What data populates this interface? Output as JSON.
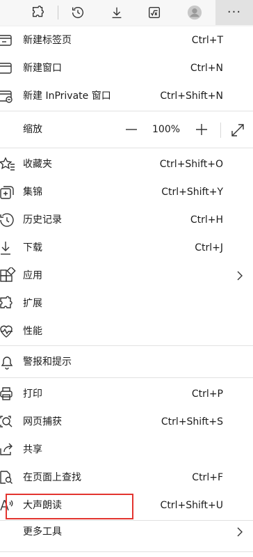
{
  "toolbar": {
    "icons": [
      "extensions-icon",
      "history-icon",
      "download-icon",
      "math-solver-icon",
      "profile-avatar-icon",
      "more-icon"
    ],
    "more_label": "···"
  },
  "menu": {
    "new_tab": {
      "label": "新建标签页",
      "shortcut": "Ctrl+T"
    },
    "new_window": {
      "label": "新建窗口",
      "shortcut": "Ctrl+N"
    },
    "new_inprivate": {
      "label": "新建 InPrivate 窗口",
      "shortcut": "Ctrl+Shift+N"
    },
    "zoom": {
      "label": "缩放",
      "value": "100%",
      "minus": "−",
      "plus": "+"
    },
    "favorites": {
      "label": "收藏夹",
      "shortcut": "Ctrl+Shift+O"
    },
    "collections": {
      "label": "集锦",
      "shortcut": "Ctrl+Shift+Y"
    },
    "history": {
      "label": "历史记录",
      "shortcut": "Ctrl+H"
    },
    "downloads": {
      "label": "下载",
      "shortcut": "Ctrl+J"
    },
    "apps": {
      "label": "应用"
    },
    "extensions": {
      "label": "扩展"
    },
    "performance": {
      "label": "性能"
    },
    "alerts": {
      "label": "警报和提示"
    },
    "print": {
      "label": "打印",
      "shortcut": "Ctrl+P"
    },
    "web_capture": {
      "label": "网页捕获",
      "shortcut": "Ctrl+Shift+S"
    },
    "share": {
      "label": "共享"
    },
    "find": {
      "label": "在页面上查找",
      "shortcut": "Ctrl+F"
    },
    "read_aloud": {
      "label": "大声朗读",
      "shortcut": "Ctrl+Shift+U"
    },
    "more_tools": {
      "label": "更多工具"
    }
  },
  "colors": {
    "highlight": "#e3342f",
    "menu_bg": "#ffffff",
    "toolbar_bg": "#f7f7f7"
  }
}
